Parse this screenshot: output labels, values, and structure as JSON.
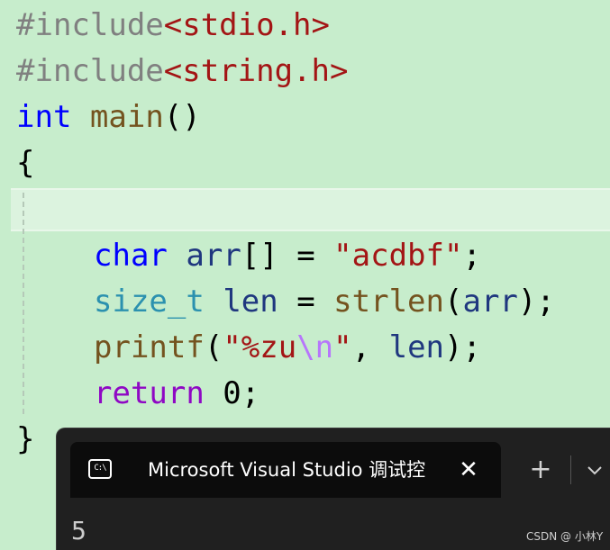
{
  "code": {
    "line1": {
      "directive": "#include",
      "header": "<stdio.h>"
    },
    "line2": {
      "directive": "#include",
      "header": "<string.h>"
    },
    "line3": {
      "kw": "int",
      "name": "main",
      "parens": "()"
    },
    "line4": {
      "brace": "{"
    },
    "line6": {
      "kw": "char",
      "name": "arr",
      "brackets": "[]",
      "op": " = ",
      "str": "\"acdbf\"",
      "semi": ";"
    },
    "line7": {
      "type": "size_t",
      "name": "len",
      "op": " = ",
      "fn": "strlen",
      "open": "(",
      "arg": "arr",
      "close": ");"
    },
    "line8": {
      "fn": "printf",
      "open": "(",
      "str_a": "\"%zu",
      "esc": "\\n",
      "str_b": "\"",
      "comma": ", ",
      "arg": "len",
      "close": ");"
    },
    "line9": {
      "kw": "return",
      "val": " 0;"
    },
    "line10": {
      "brace": "}"
    }
  },
  "terminal": {
    "tab_icon_text": "C:\\",
    "tab_title": "Microsoft Visual Studio 调试控",
    "close_symbol": "✕",
    "new_tab_symbol": "+",
    "output": "5"
  },
  "watermark": "CSDN @ 小林Y"
}
